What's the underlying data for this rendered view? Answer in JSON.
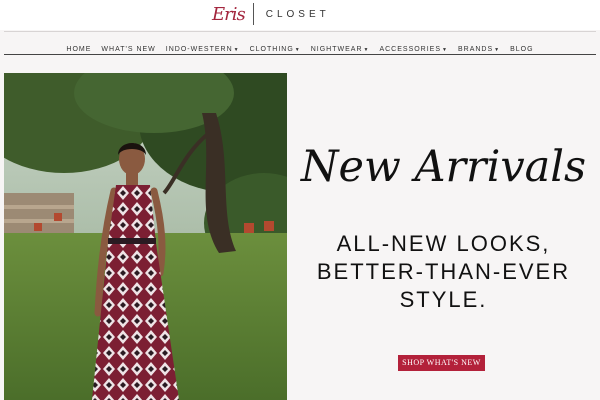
{
  "brand": {
    "script": "Eris",
    "word": "CLOSET"
  },
  "nav": {
    "items": [
      {
        "label": "HOME",
        "dropdown": false
      },
      {
        "label": "WHAT'S NEW",
        "dropdown": false
      },
      {
        "label": "INDO-WESTERN",
        "dropdown": true
      },
      {
        "label": "CLOTHING",
        "dropdown": true
      },
      {
        "label": "NIGHTWEAR",
        "dropdown": true
      },
      {
        "label": "ACCESSORIES",
        "dropdown": true
      },
      {
        "label": "BRANDS",
        "dropdown": true
      },
      {
        "label": "BLOG",
        "dropdown": false
      }
    ]
  },
  "hero": {
    "title": "New Arrivals",
    "subtitle_lines": [
      "ALL-NEW LOOKS,",
      "BETTER-THAN-EVER",
      "STYLE."
    ],
    "cta": "SHOP WHAT'S NEW"
  },
  "colors": {
    "accent": "#b3213a",
    "logo": "#a3253d"
  }
}
